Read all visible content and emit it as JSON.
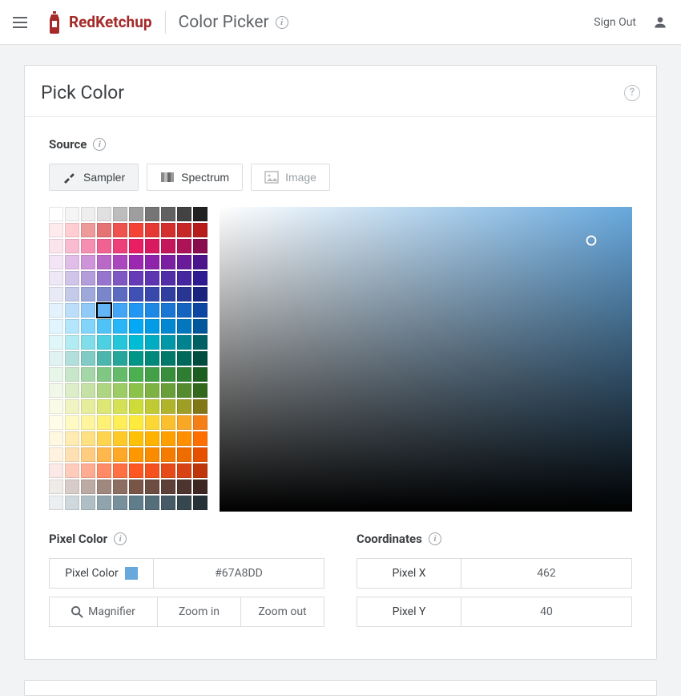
{
  "header": {
    "brand": "RedKetchup",
    "tool": "Color Picker",
    "sign_out": "Sign Out"
  },
  "card": {
    "title": "Pick Color",
    "source_label": "Source",
    "source_buttons": {
      "sampler": "Sampler",
      "spectrum": "Spectrum",
      "image": "Image"
    }
  },
  "palette_colors": [
    "#FFFFFF",
    "#F5F5F5",
    "#EEEEEE",
    "#E0E0E0",
    "#BDBDBD",
    "#9E9E9E",
    "#757575",
    "#616161",
    "#424242",
    "#212121",
    "#FFEBEE",
    "#FFCDD2",
    "#EF9A9A",
    "#E57373",
    "#EF5350",
    "#F44336",
    "#E53935",
    "#D32F2F",
    "#C62828",
    "#B71C1C",
    "#FCE4EC",
    "#F8BBD0",
    "#F48FB1",
    "#F06292",
    "#EC407A",
    "#E91E63",
    "#D81B60",
    "#C2185B",
    "#AD1457",
    "#880E4F",
    "#F3E5F5",
    "#E1BEE7",
    "#CE93D8",
    "#BA68C8",
    "#AB47BC",
    "#9C27B0",
    "#8E24AA",
    "#7B1FA2",
    "#6A1B9A",
    "#4A148C",
    "#EDE7F6",
    "#D1C4E9",
    "#B39DDB",
    "#9575CD",
    "#7E57C2",
    "#673AB7",
    "#5E35B1",
    "#512DA8",
    "#4527A0",
    "#311B92",
    "#E8EAF6",
    "#C5CAE9",
    "#9FA8DA",
    "#7986CB",
    "#5C6BC0",
    "#3F51B5",
    "#3949AB",
    "#303F9F",
    "#283593",
    "#1A237E",
    "#E3F2FD",
    "#BBDEFB",
    "#90CAF9",
    "#64B5F6",
    "#42A5F5",
    "#2196F3",
    "#1E88E5",
    "#1976D2",
    "#1565C0",
    "#0D47A1",
    "#E1F5FE",
    "#B3E5FC",
    "#81D4FA",
    "#4FC3F7",
    "#29B6F6",
    "#03A9F4",
    "#039BE5",
    "#0288D1",
    "#0277BD",
    "#01579B",
    "#E0F7FA",
    "#B2EBF2",
    "#80DEEA",
    "#4DD0E1",
    "#26C6DA",
    "#00BCD4",
    "#00ACC1",
    "#0097A7",
    "#00838F",
    "#006064",
    "#E0F2F1",
    "#B2DFDB",
    "#80CBC4",
    "#4DB6AC",
    "#26A69A",
    "#009688",
    "#00897B",
    "#00796B",
    "#00695C",
    "#004D40",
    "#E8F5E9",
    "#C8E6C9",
    "#A5D6A7",
    "#81C784",
    "#66BB6A",
    "#4CAF50",
    "#43A047",
    "#388E3C",
    "#2E7D32",
    "#1B5E20",
    "#F1F8E9",
    "#DCEDC8",
    "#C5E1A5",
    "#AED581",
    "#9CCC65",
    "#8BC34A",
    "#7CB342",
    "#689F38",
    "#558B2F",
    "#33691E",
    "#F9FBE7",
    "#F0F4C3",
    "#E6EE9C",
    "#DCE775",
    "#D4E157",
    "#CDDC39",
    "#C0CA33",
    "#AFB42B",
    "#9E9D24",
    "#827717",
    "#FFFDE7",
    "#FFF9C4",
    "#FFF59D",
    "#FFF176",
    "#FFEE58",
    "#FFEB3B",
    "#FDD835",
    "#FBC02D",
    "#F9A825",
    "#F57F17",
    "#FFF8E1",
    "#FFECB3",
    "#FFE082",
    "#FFD54F",
    "#FFCA28",
    "#FFC107",
    "#FFB300",
    "#FFA000",
    "#FF8F00",
    "#FF6F00",
    "#FFF3E0",
    "#FFE0B2",
    "#FFCC80",
    "#FFB74D",
    "#FFA726",
    "#FF9800",
    "#FB8C00",
    "#F57C00",
    "#EF6C00",
    "#E65100",
    "#FBE9E7",
    "#FFCCBC",
    "#FFAB91",
    "#FF8A65",
    "#FF7043",
    "#FF5722",
    "#F4511E",
    "#E64A19",
    "#D84315",
    "#BF360C",
    "#EFEBE9",
    "#D7CCC8",
    "#BCAAA4",
    "#A1887F",
    "#8D6E63",
    "#795548",
    "#6D4C41",
    "#5D4037",
    "#4E342E",
    "#3E2723",
    "#ECEFF1",
    "#CFD8DC",
    "#B0BEC5",
    "#90A4AE",
    "#78909C",
    "#607D8B",
    "#546E7A",
    "#455A64",
    "#37474F",
    "#263238"
  ],
  "selected_swatch_index": 63,
  "pixel_color": {
    "section_label": "Pixel Color",
    "field_label": "Pixel Color",
    "hex": "#67A8DD",
    "magnifier": "Magnifier",
    "zoom_in": "Zoom in",
    "zoom_out": "Zoom out"
  },
  "coordinates": {
    "section_label": "Coordinates",
    "x_label": "Pixel X",
    "x_value": "462",
    "y_label": "Pixel Y",
    "y_value": "40"
  },
  "gradient_cursor": {
    "left_pct": 90,
    "top_pct": 11
  }
}
